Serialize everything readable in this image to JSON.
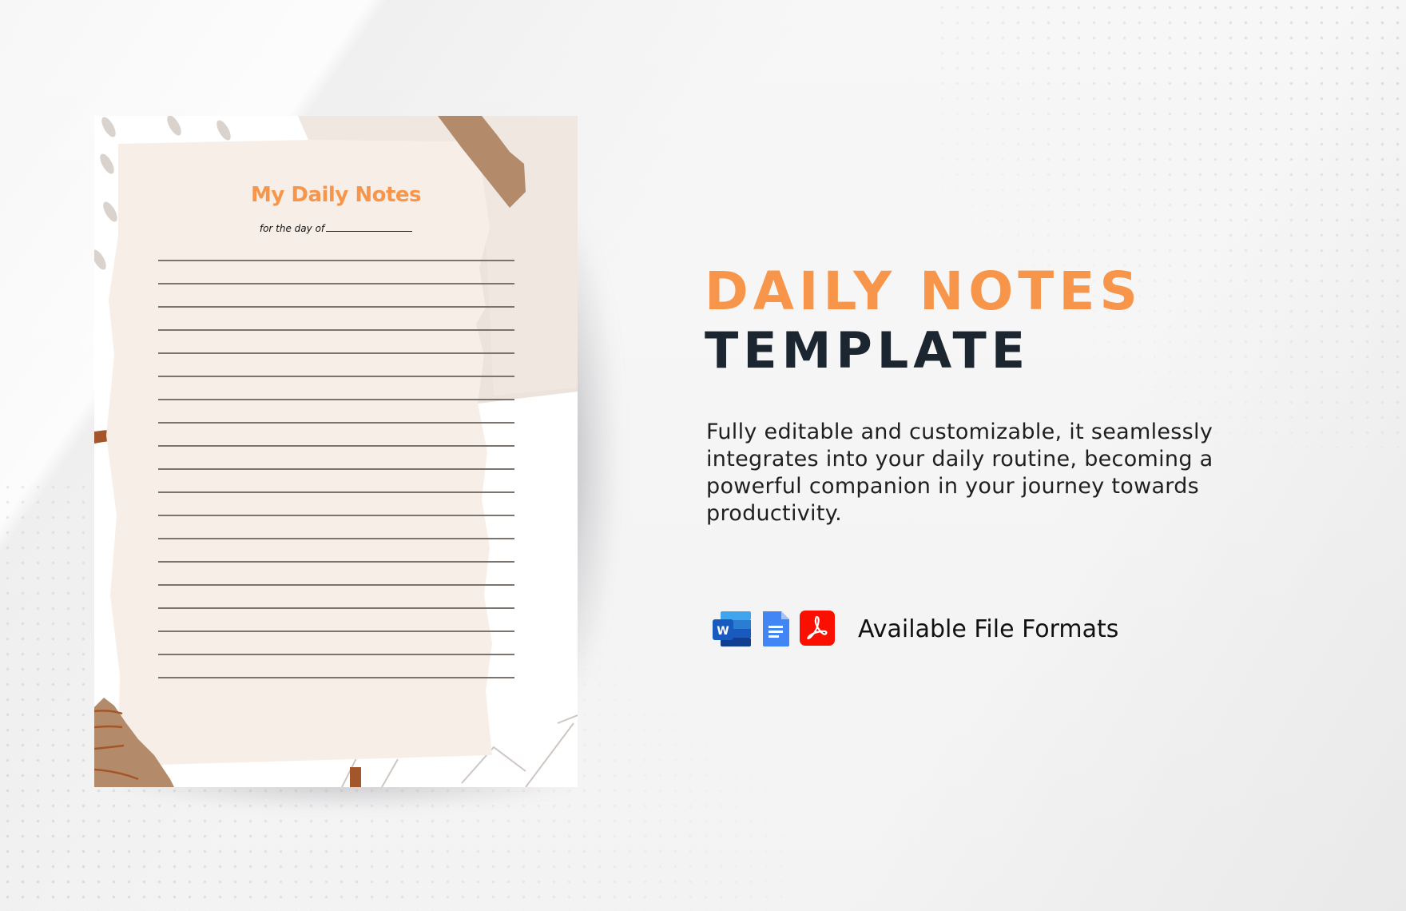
{
  "preview": {
    "title": "My Daily Notes",
    "subtitle": "for the day of",
    "line_count": 19
  },
  "headline": {
    "line1": "DAILY NOTES",
    "line2": "TEMPLATE"
  },
  "description": "Fully editable and customizable, it seamlessly integrates into your daily routine, becoming a powerful companion in your journey towards productivity.",
  "formats": {
    "label": "Available File Formats",
    "icons": [
      "word-icon",
      "google-docs-icon",
      "pdf-icon"
    ]
  },
  "colors": {
    "accent": "#f7964a",
    "dark": "#1b2631",
    "paper": "#f7eee7",
    "tape": "#b38b6a"
  }
}
